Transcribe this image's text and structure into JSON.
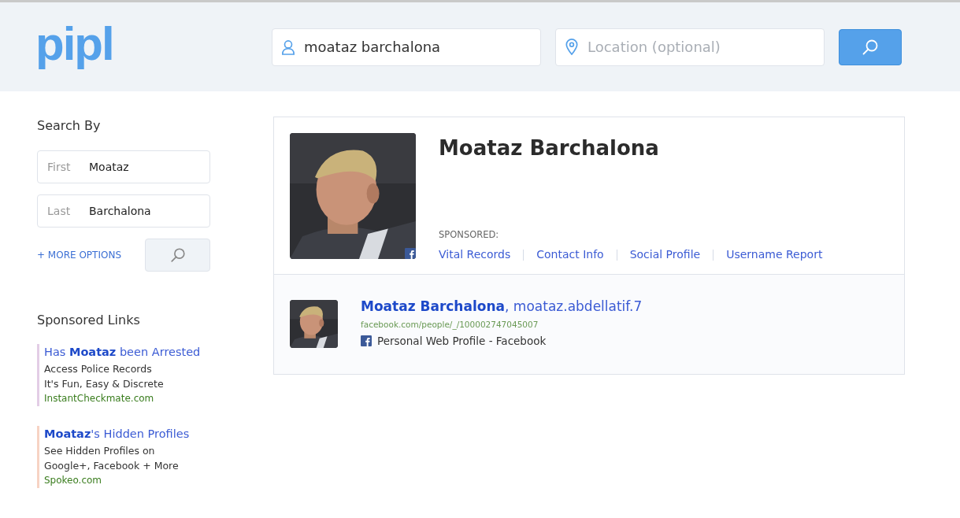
{
  "logo": "pipl",
  "search": {
    "name_value": "moataz barchalona",
    "location_placeholder": "Location (optional)"
  },
  "sidebar": {
    "title": "Search By",
    "fields": [
      {
        "label": "First",
        "value": "Moataz"
      },
      {
        "label": "Last",
        "value": "Barchalona"
      }
    ],
    "more_options": "+ MORE OPTIONS",
    "sponsored_title": "Sponsored Links",
    "ads": [
      {
        "headline": "Has **Moataz** been Arrested",
        "lines": [
          "Access Police Records",
          "It's Fun, Easy & Discrete"
        ],
        "url": "InstantCheckmate.com",
        "color": "#e3cde6"
      },
      {
        "headline": "**Moataz**'s Hidden Profiles",
        "lines": [
          "See Hidden Profiles on",
          "Google+, Facebook + More"
        ],
        "url": "Spokeo.com",
        "color": "#f7d3c4"
      }
    ]
  },
  "profile": {
    "name": "Moataz Barchalona",
    "sponsored_label": "SPONSORED:",
    "links": [
      "Vital Records",
      "Contact Info",
      "Social Profile",
      "Username Report"
    ]
  },
  "results": [
    {
      "name": "Moataz Barchalona",
      "username": ", moataz.abdellatif.7",
      "url": "facebook.com/people/_/100002747045007",
      "source": "Personal Web Profile - Facebook"
    }
  ]
}
